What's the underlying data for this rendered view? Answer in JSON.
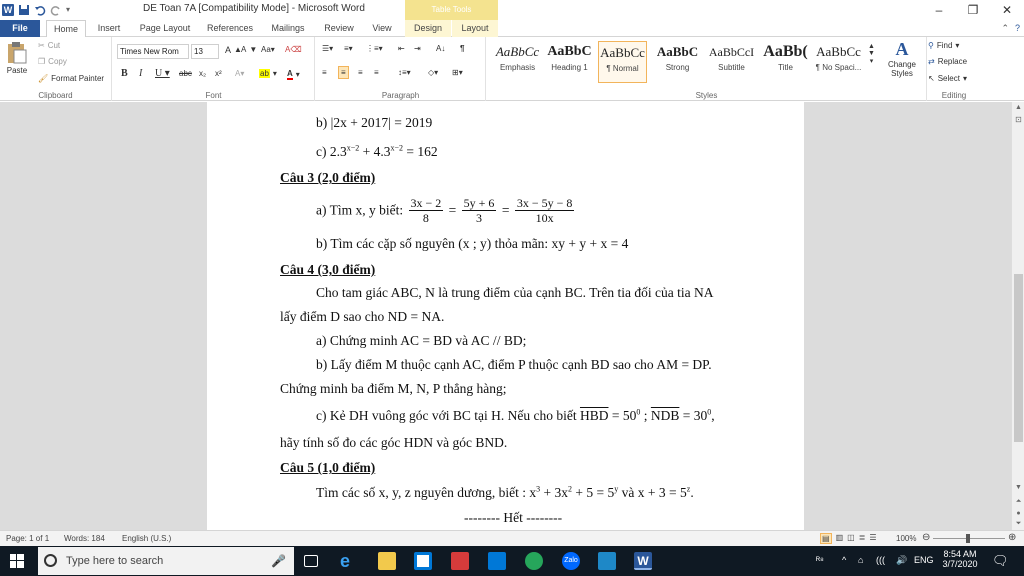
{
  "titlebar": {
    "doc_title": "DE Toan 7A [Compatibility Mode] - Microsoft Word",
    "context_tab_group": "Table Tools",
    "quick_access": [
      "save-icon",
      "undo-icon",
      "redo-icon",
      "customize-qat-icon"
    ]
  },
  "tabs": [
    "File",
    "Home",
    "Insert",
    "Page Layout",
    "References",
    "Mailings",
    "Review",
    "View",
    "Design",
    "Layout"
  ],
  "ribbon": {
    "clipboard": {
      "paste": "Paste",
      "cut": "Cut",
      "copy": "Copy",
      "format_painter": "Format Painter",
      "label": "Clipboard"
    },
    "font": {
      "name": "Times New Rom",
      "size": "13",
      "label": "Font"
    },
    "paragraph": {
      "label": "Paragraph"
    },
    "styles": {
      "label": "Styles",
      "items": [
        {
          "sample": "AaBbCc",
          "name": "Emphasis"
        },
        {
          "sample": "AaBbC",
          "name": "Heading 1"
        },
        {
          "sample": "AaBbCc",
          "name": "¶ Normal"
        },
        {
          "sample": "AaBbC",
          "name": "Strong"
        },
        {
          "sample": "AaBbCcI",
          "name": "Subtitle"
        },
        {
          "sample": "AaBb(",
          "name": "Title"
        },
        {
          "sample": "AaBbCc",
          "name": "¶ No Spaci..."
        }
      ],
      "change_styles": "Change Styles"
    },
    "editing": {
      "find": "Find",
      "replace": "Replace",
      "select": "Select",
      "label": "Editing"
    }
  },
  "document": {
    "line_b": "b) |2x + 2017| = 2019",
    "line_c_prefix": "c)  2.3",
    "line_c_exp1": "x−2",
    "line_c_mid": " + 4.3",
    "line_c_exp2": "x−2",
    "line_c_end": " = 162",
    "cau3": "Câu 3 (2,0 điểm)",
    "cau3_a_prefix": "a) Tìm x, y biết:",
    "frac1_num": "3x − 2",
    "frac1_den": "8",
    "frac2_num": "5y + 6",
    "frac2_den": "3",
    "frac3_num": "3x − 5y − 8",
    "frac3_den": "10x",
    "cau3_b": "b) Tìm các cặp số nguyên (x ; y) thỏa mãn: xy + y + x = 4",
    "cau4": "Câu 4 (3,0 điểm)",
    "cau4_intro1": "Cho tam giác ABC, N là trung điểm của cạnh BC. Trên tia đối của tia NA",
    "cau4_intro2": "lấy điểm D sao cho ND = NA.",
    "cau4_a": "a) Chứng minh AC = BD và AC // BD;",
    "cau4_b1": "b) Lấy điểm M thuộc cạnh AC, điểm P thuộc cạnh BD sao cho AM = DP.",
    "cau4_b2": "Chứng minh ba điểm M, N, P thẳng hàng;",
    "cau4_c1_prefix": "c) Kẻ DH vuông góc với BC tại H. Nếu cho biết ",
    "cau4_c1_angle1": "HBD",
    "cau4_c1_val1": " = 50",
    "cau4_c1_deg": "0",
    "cau4_c1_angle2": "NDB",
    "cau4_c1_val2": " = 30",
    "cau4_c2": "hãy tính số đo các góc HDN và góc BND.",
    "cau5": "Câu 5 (1,0 điểm)",
    "cau5_prefix": "Tìm các số x, y, z nguyên dương, biết :  x",
    "cau5_e1": "3",
    "cau5_p2": " + 3x",
    "cau5_e2": "2",
    "cau5_p3": " + 5 = 5",
    "cau5_e3": "y",
    "cau5_p4": "  và  x + 3 = 5",
    "cau5_e4": "z",
    "end": "-------- Hết --------"
  },
  "statusbar": {
    "page": "Page: 1 of 1",
    "words": "Words: 184",
    "language": "English (U.S.)",
    "zoom": "100%"
  },
  "taskbar": {
    "search_placeholder": "Type here to search",
    "language": "ENG",
    "time": "8:54 AM",
    "date": "3/7/2020"
  }
}
